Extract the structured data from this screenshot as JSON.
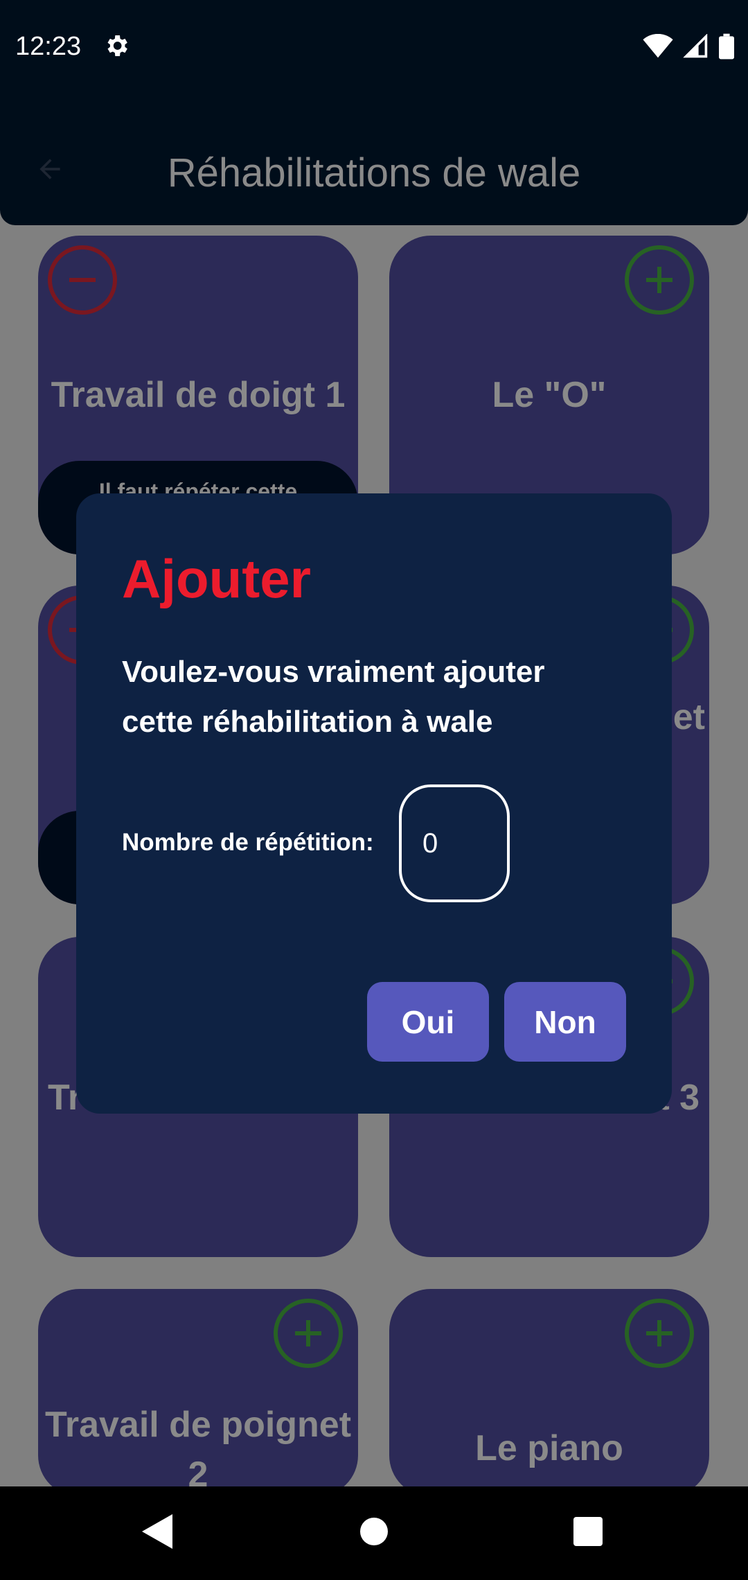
{
  "status_bar": {
    "time": "12:23",
    "icons": [
      "gear-icon",
      "wifi-icon",
      "signal-icon",
      "battery-icon"
    ]
  },
  "app_bar": {
    "title": "Réhabilitations de  wale",
    "back_icon": "arrow-left-icon"
  },
  "cards": [
    {
      "title": "Travail de doigt 1",
      "action": "remove",
      "note": "Il faut répéter cette"
    },
    {
      "title": "Le \"O\"",
      "action": "add"
    },
    {
      "title": "",
      "action": "remove"
    },
    {
      "title": "et",
      "action": "add"
    },
    {
      "title": "Tr",
      "action": "none"
    },
    {
      "title": "t 3",
      "action": "add"
    },
    {
      "title": "Travail de poignet 2",
      "action": "add"
    },
    {
      "title": "Le piano",
      "action": "add"
    }
  ],
  "dialog": {
    "title": "Ajouter",
    "message": "Voulez-vous vraiment ajouter cette réhabilitation à  wale",
    "repetition_label": "Nombre de répétition:",
    "repetition_value": "0",
    "yes_label": "Oui",
    "no_label": "Non"
  },
  "colors": {
    "dialog_bg": "#0e2243",
    "dialog_title": "#ec1c2d",
    "button_bg": "#5658bc",
    "card_bg": "#2c2a57",
    "overlay": "#808080"
  },
  "nav_bar": {
    "icons": [
      "back-triangle-icon",
      "home-circle-icon",
      "recents-square-icon"
    ]
  }
}
